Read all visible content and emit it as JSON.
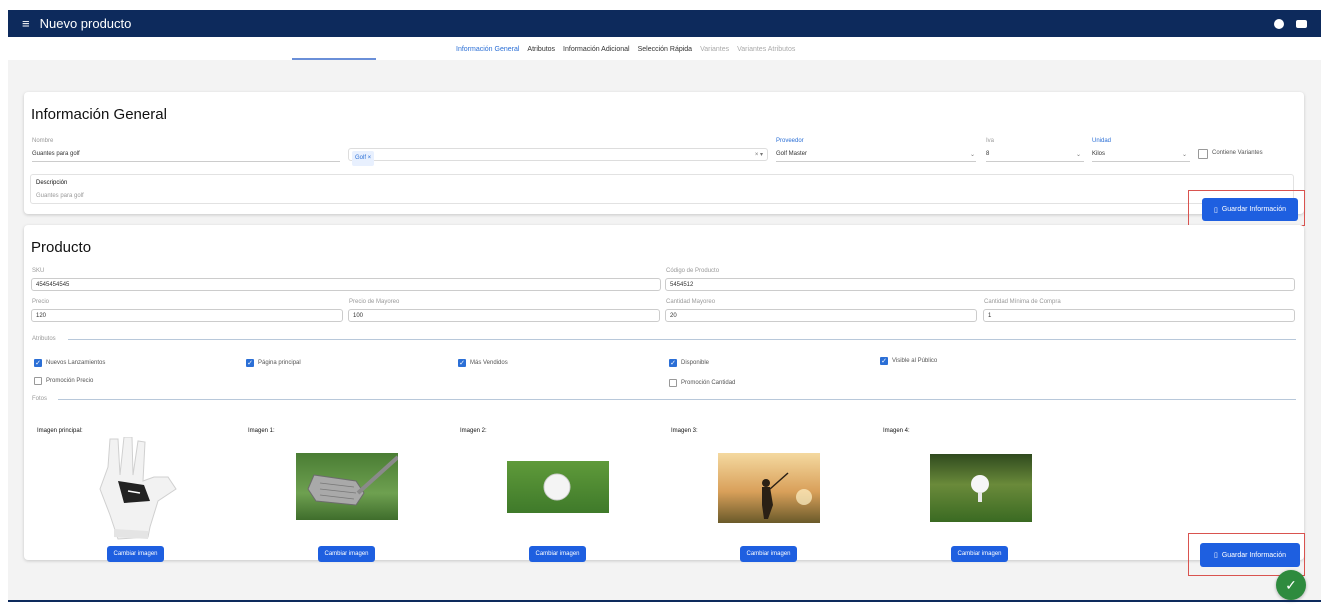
{
  "appbar": {
    "menu_icon": "menu-icon",
    "title": "Nuevo producto",
    "right_icons": [
      "help-icon",
      "account-icon"
    ]
  },
  "tabs": [
    {
      "label": "Información General",
      "state": "active"
    },
    {
      "label": "Atributos",
      "state": "normal"
    },
    {
      "label": "Información Adicional",
      "state": "normal"
    },
    {
      "label": "Selección Rápida",
      "state": "normal"
    },
    {
      "label": "Variantes",
      "state": "disabled"
    },
    {
      "label": "Variantes Atributos",
      "state": "disabled"
    }
  ],
  "general": {
    "title": "Información General",
    "nombre_label": "Nombre",
    "nombre_value": "Guantes para golf",
    "categoria_chip": "Golf ×",
    "categoria_clear": "× ▾",
    "proveedor_label": "Proveedor",
    "proveedor_value": "Golf Master",
    "iva_label": "Iva",
    "iva_value": "8",
    "unidad_label": "Unidad",
    "unidad_value": "Kilos",
    "contiene_variantes": "Contiene Variantes",
    "descripcion_label": "Descripción",
    "descripcion_value": "Guantes para golf"
  },
  "save_button": "Guardar Información",
  "producto": {
    "title": "Producto",
    "sku_label": "SKU",
    "sku_value": "4545454545",
    "codigo_label": "Código de Producto",
    "codigo_value": "5454512",
    "precio_label": "Precio",
    "precio_value": "120",
    "precio_mayoreo_label": "Precio de Mayoreo",
    "precio_mayoreo_value": "100",
    "cantidad_mayoreo_label": "Cantidad Mayoreo",
    "cantidad_mayoreo_value": "20",
    "cantidad_minima_label": "Cantidad Mínima de Compra",
    "cantidad_minima_value": "1",
    "atributos_label": "Atributos",
    "fotos_label": "Fotos",
    "checkboxes": [
      {
        "label": "Nuevos Lanzamientos",
        "checked": true
      },
      {
        "label": "Página principal",
        "checked": true
      },
      {
        "label": "Más Vendidos",
        "checked": true
      },
      {
        "label": "Disponible",
        "checked": true
      },
      {
        "label": "Visible al Público",
        "checked": true
      },
      {
        "label": "Promoción Precio",
        "checked": false
      },
      {
        "label": "Promoción Cantidad",
        "checked": false
      }
    ],
    "images": [
      {
        "label": "Imagen principal:",
        "button": "Cambiar imagen"
      },
      {
        "label": "Imagen 1:",
        "button": "Cambiar imagen"
      },
      {
        "label": "Imagen 2:",
        "button": "Cambiar imagen"
      },
      {
        "label": "Imagen 3:",
        "button": "Cambiar imagen"
      },
      {
        "label": "Imagen 4:",
        "button": "Cambiar imagen"
      }
    ]
  },
  "fab_icon": "check-icon",
  "colors": {
    "appbar": "#0d2a5c",
    "accent": "#1e5fe0",
    "success": "#2e8b3e",
    "highlight": "#d9534f"
  }
}
